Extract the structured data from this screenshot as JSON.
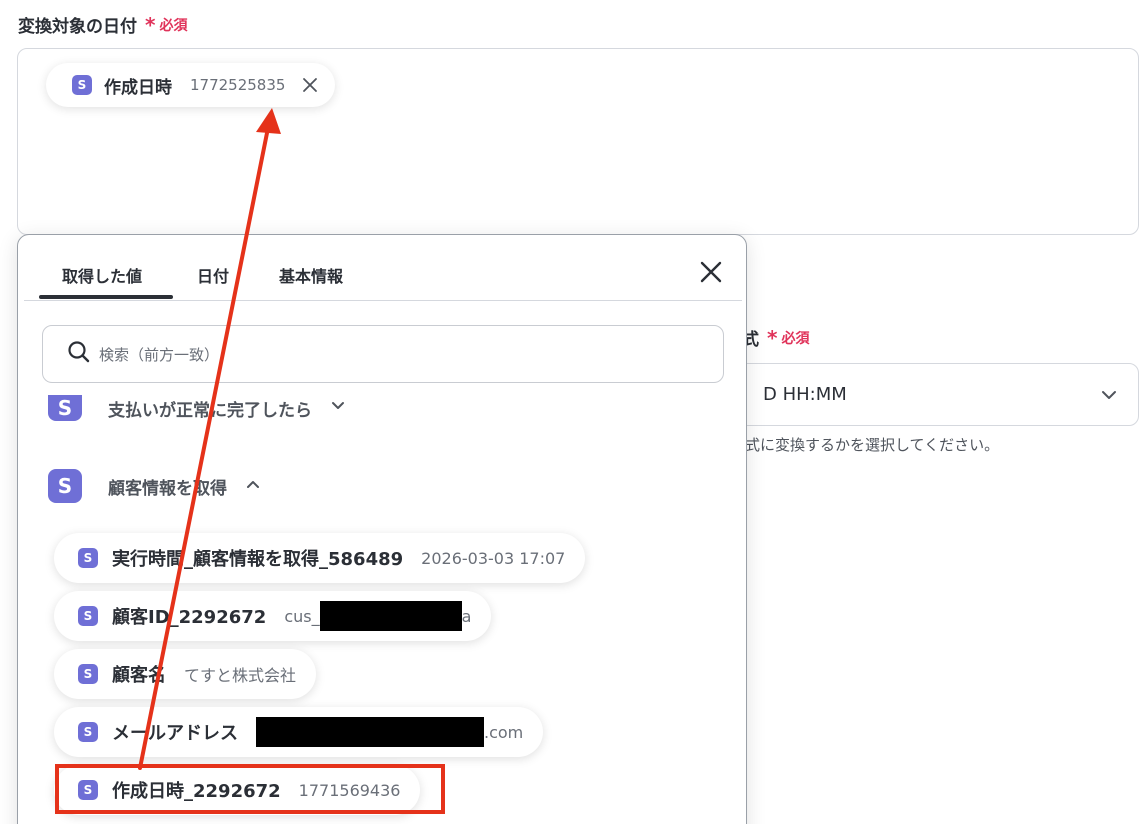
{
  "target_field": {
    "label": "変換対象の日付",
    "required_star": "*",
    "required_text": "必須",
    "selected_chip": {
      "icon": "S",
      "name": "作成日時",
      "value": "1772525835"
    }
  },
  "format_field": {
    "label_partial": "式",
    "required_star": "*",
    "required_text": "必須",
    "selected_value_partial": "D HH:MM",
    "help_partial": "式に変換するかを選択してください。"
  },
  "picker": {
    "tabs": [
      "取得した値",
      "日付",
      "基本情報"
    ],
    "active_tab": "取得した値",
    "search_placeholder": "検索（前方一致）",
    "sections": [
      {
        "icon": "S",
        "label": "支払いが正常に完了したら",
        "expanded": false
      },
      {
        "icon": "S",
        "label": "顧客情報を取得",
        "expanded": true
      }
    ],
    "items": [
      {
        "icon": "S",
        "name": "実行時間_顧客情報を取得_586489",
        "value": "2026-03-03 17:07"
      },
      {
        "icon": "S",
        "name": "顧客ID_2292672",
        "value_prefix": "cus_",
        "value_suffix": "a"
      },
      {
        "icon": "S",
        "name": "顧客名",
        "value": "てすと株式会社"
      },
      {
        "icon": "S",
        "name": "メールアドレス",
        "value_suffix": ".com"
      },
      {
        "icon": "S",
        "name": "作成日時_2292672",
        "value": "1771569436"
      }
    ]
  },
  "colors": {
    "accent": "#6f6fd6",
    "required": "#e0335a",
    "annotation": "#e5321a"
  }
}
